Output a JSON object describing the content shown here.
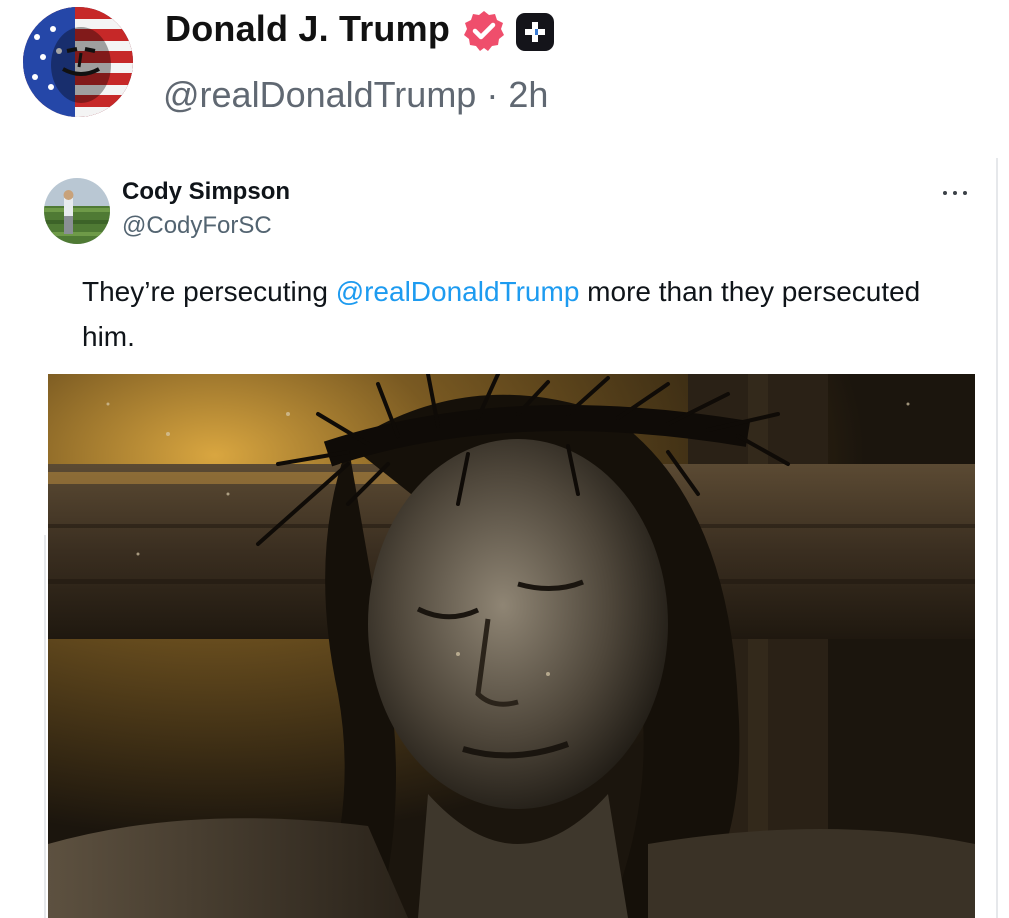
{
  "post": {
    "author_name": "Donald J. Trump",
    "handle": "@realDonaldTrump",
    "separator": "·",
    "time": "2h",
    "verified_icon": "verified-badge-icon",
    "plus_icon": "plus-badge-icon",
    "colors": {
      "verified": "#ef4e6c",
      "name": "#111111",
      "meta": "#606872"
    }
  },
  "quoted": {
    "name": "Cody Simpson",
    "handle": "@CodyForSC",
    "text_before": "They’re persecuting ",
    "mention": "@realDonaldTrump",
    "text_after": " more than they persecuted him.",
    "more_icon": "more-options-icon",
    "colors": {
      "mention": "#1d9bf0",
      "handle": "#536471"
    }
  }
}
